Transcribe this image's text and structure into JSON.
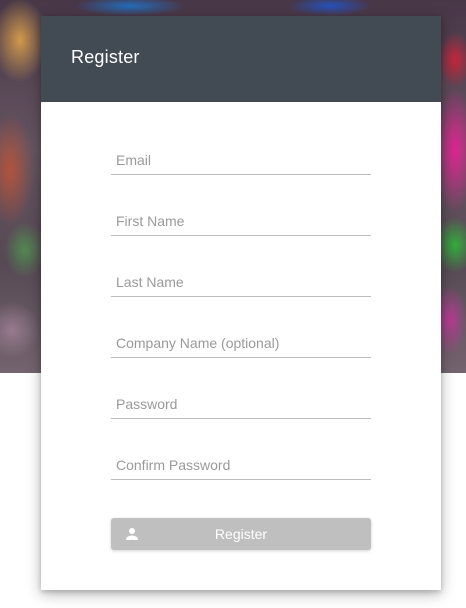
{
  "background": {
    "description_icon": "blurred-photo"
  },
  "card": {
    "title": "Register",
    "header_color": "#424b53",
    "fields": [
      {
        "name": "email",
        "placeholder": "Email",
        "value": ""
      },
      {
        "name": "first_name",
        "placeholder": "First Name",
        "value": ""
      },
      {
        "name": "last_name",
        "placeholder": "Last Name",
        "value": ""
      },
      {
        "name": "company_name",
        "placeholder": "Company Name (optional)",
        "value": ""
      },
      {
        "name": "password",
        "placeholder": "Password",
        "value": ""
      },
      {
        "name": "confirm_password",
        "placeholder": "Confirm Password",
        "value": ""
      }
    ],
    "submit": {
      "label": "Register",
      "icon": "person-icon",
      "color": "#bfbfbf"
    }
  }
}
